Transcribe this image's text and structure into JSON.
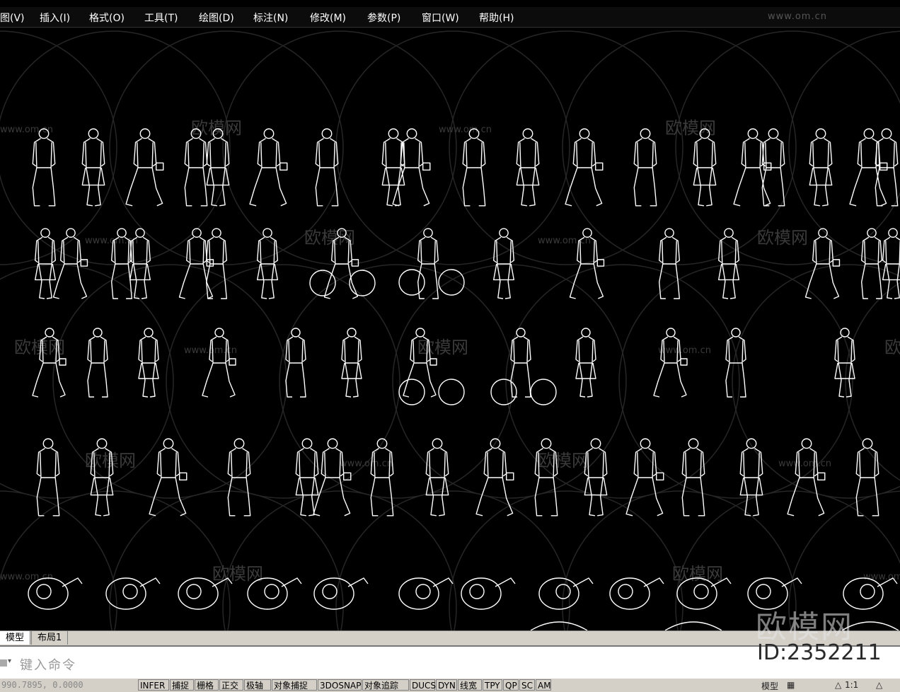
{
  "menu": {
    "items": [
      {
        "label": "图(V)"
      },
      {
        "label": "插入(I)"
      },
      {
        "label": "格式(O)"
      },
      {
        "label": "工具(T)"
      },
      {
        "label": "绘图(D)"
      },
      {
        "label": "标注(N)"
      },
      {
        "label": "修改(M)"
      },
      {
        "label": "参数(P)"
      },
      {
        "label": "窗口(W)"
      },
      {
        "label": "帮助(H)"
      }
    ],
    "watermark": "www.om.cn"
  },
  "canvas": {
    "watermark_text": "欧模网",
    "watermark_url": "www.om.cn",
    "stroke_color": "#ffffff",
    "background_color": "#000000",
    "watermark_color": "#3a3a3a"
  },
  "tabs": {
    "model": "模型",
    "layout1": "布局1"
  },
  "command": {
    "prompt": "键入命令"
  },
  "status": {
    "coords": "990.7895, 0.0000",
    "buttons": [
      "INFER",
      "捕捉",
      "栅格",
      "正交",
      "极轴",
      "对象捕捉",
      "3DOSNAP",
      "对象追踪",
      "DUCS",
      "DYN",
      "线宽",
      "TPY",
      "QP",
      "SC",
      "AM"
    ],
    "right_model": "模型",
    "scale": "1:1"
  },
  "watermark": {
    "brand": "欧模网",
    "id": "ID:2352211"
  }
}
